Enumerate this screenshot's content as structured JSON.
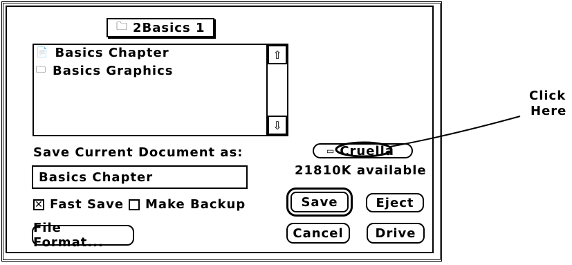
{
  "dialog": {
    "folder_popup": {
      "label": "2Basics 1",
      "icon": "folder-icon"
    },
    "file_list": {
      "items": [
        {
          "label": "Basics Chapter",
          "icon": "document-icon"
        },
        {
          "label": "Basics Graphics",
          "icon": "folder-icon"
        }
      ],
      "scroll_up_icon": "arrow-up-icon",
      "scroll_down_icon": "arrow-down-icon"
    },
    "save_prompt": "Save Current Document as:",
    "filename_value": "Basics Chapter",
    "options": {
      "fast_save": {
        "label": "Fast Save",
        "checked": true
      },
      "make_backup": {
        "label": "Make Backup",
        "checked": false
      }
    },
    "file_format_button": "File Format...",
    "drive": {
      "label": "Cruella",
      "icon": "disk-icon",
      "available": "21810K available"
    },
    "buttons": {
      "save": "Save",
      "eject": "Eject",
      "cancel": "Cancel",
      "drive": "Drive"
    }
  },
  "annotation": {
    "line1": "Click",
    "line2": "Here"
  }
}
